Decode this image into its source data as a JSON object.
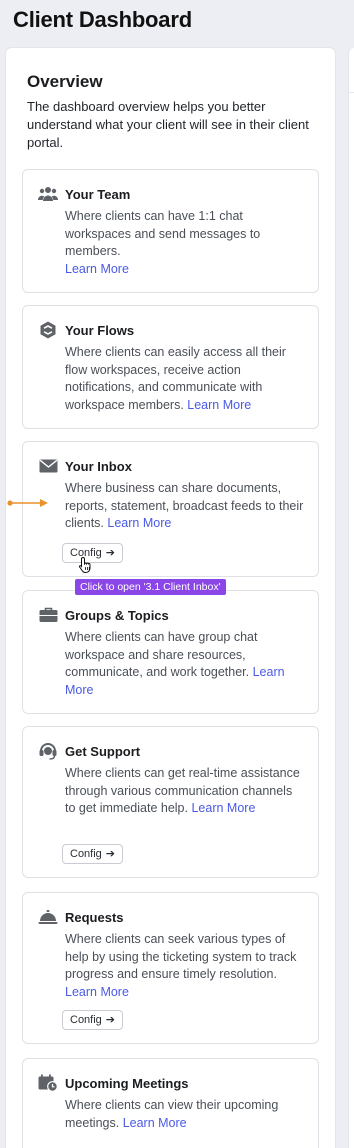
{
  "page": {
    "title": "Client Dashboard"
  },
  "overview": {
    "title": "Overview",
    "description": "The dashboard overview helps you better understand what your client will see in their client portal."
  },
  "cards": [
    {
      "title": "Your Team",
      "description": "Where clients can have 1:1 chat workspaces and send messages to members.",
      "link": "Learn More",
      "icon": "team-icon"
    },
    {
      "title": "Your Flows",
      "description": "Where clients can easily access all their flow workspaces, receive action notifications, and communicate with workspace members.",
      "link": "Learn More",
      "icon": "flows-icon"
    },
    {
      "title": "Your Inbox",
      "description": "Where business can share documents, reports, statement, broadcast feeds to their clients.",
      "link": "Learn More",
      "icon": "mail-icon",
      "button": "Config"
    },
    {
      "title": "Groups & Topics",
      "description": "Where clients can have group chat workspace and share resources, communicate, and work together.",
      "link": "Learn More",
      "icon": "briefcase-icon"
    },
    {
      "title": "Get Support",
      "description": "Where clients can get real-time assistance through various communication channels to get immediate help.",
      "link": "Learn More",
      "icon": "headset-icon",
      "button": "Config"
    },
    {
      "title": "Requests",
      "description": "Where clients can seek various types of help by using the ticketing system to track progress and ensure timely resolution.",
      "link": "Learn More",
      "icon": "service-bell-icon",
      "button": "Config"
    },
    {
      "title": "Upcoming Meetings",
      "description": "Where clients can view their upcoming meetings.",
      "link": "Learn More",
      "icon": "calendar-clock-icon"
    }
  ],
  "tooltip": "Click to open '3.1 Client Inbox'",
  "colors": {
    "accent_link": "#4a5ae6",
    "tooltip_bg": "#8b46e8",
    "pointer": "#e8912d",
    "icon_gray": "#5f6368"
  }
}
